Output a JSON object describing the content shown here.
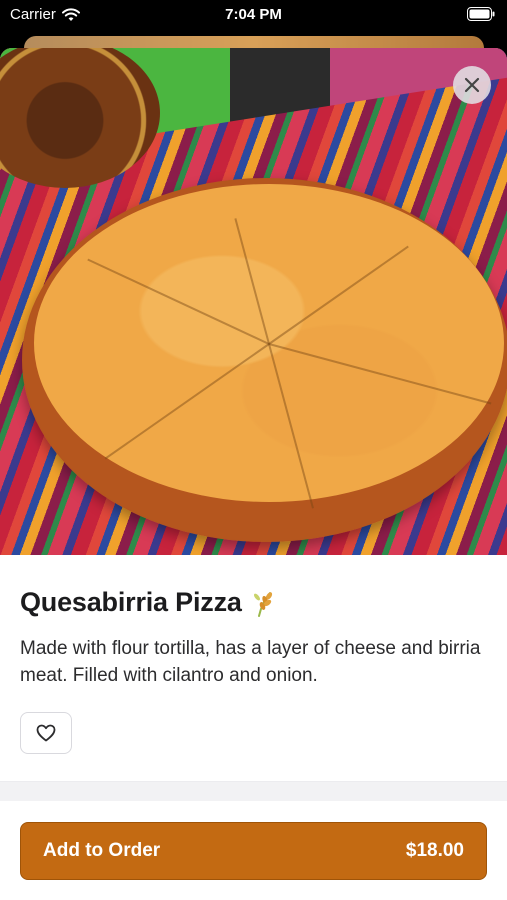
{
  "status_bar": {
    "carrier": "Carrier",
    "time": "7:04 PM"
  },
  "item": {
    "name": "Quesabirria Pizza",
    "description": "Made with flour tortilla, has a layer of cheese and birria meat. Filled with cilantro and onion.",
    "badge_icon": "wheat-icon"
  },
  "actions": {
    "favorite_icon": "heart-outline-icon",
    "add_label": "Add to Order",
    "price": "$18.00"
  },
  "colors": {
    "accent": "#c36a12",
    "text": "#1c1c1e"
  }
}
